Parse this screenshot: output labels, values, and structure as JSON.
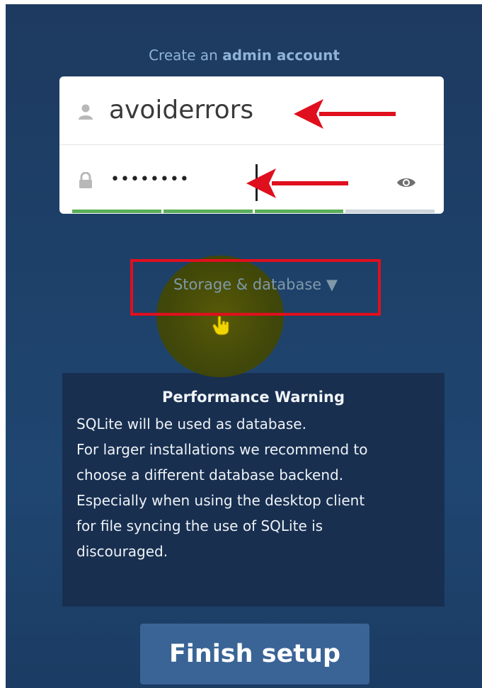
{
  "form": {
    "heading_prefix": "Create an",
    "heading_strong": "admin account"
  },
  "username": {
    "value": "avoiderrors",
    "icon": "user-icon"
  },
  "password": {
    "masked_value": "••••••••",
    "icon": "lock-icon",
    "toggle_icon": "eye-icon",
    "strength_segments_filled": 3,
    "strength_segments_total": 4
  },
  "storage": {
    "label": "Storage & database ▼"
  },
  "warning": {
    "title": "Performance Warning",
    "lines": [
      "SQLite will be used as database.",
      "For larger installations we recommend to",
      "choose a different database backend.",
      "Especially when using the desktop client",
      "for file syncing the use of SQLite is",
      "discouraged."
    ]
  },
  "actions": {
    "finish_label": "Finish setup"
  },
  "colors": {
    "background": "#1f4671",
    "annotation_red": "#e00f1e",
    "strength_green": "#5aae58",
    "button": "#3a6496",
    "highlight": "#5d5c00"
  }
}
